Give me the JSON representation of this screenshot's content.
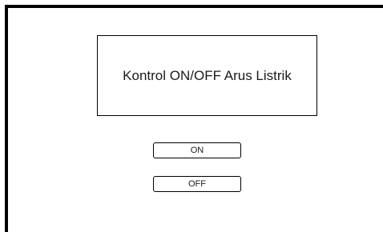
{
  "title_box": {
    "text": "Kontrol ON/OFF Arus Listrik"
  },
  "buttons": {
    "on_label": "ON",
    "off_label": "OFF"
  },
  "colors": {
    "border": "#000000",
    "background": "#ffffff",
    "text": "#1a1a1a"
  }
}
